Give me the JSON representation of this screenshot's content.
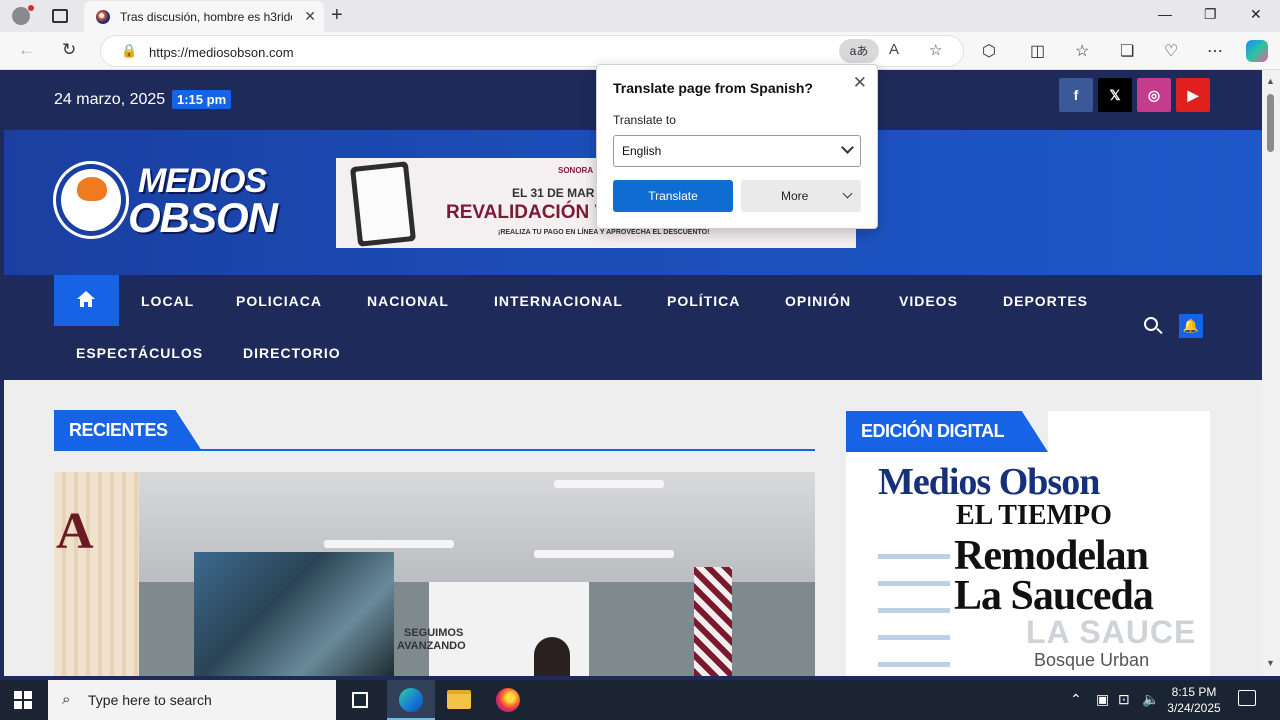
{
  "browser": {
    "tab_title": "Tras discusión, hombre es h3rido",
    "tab_close": "✕",
    "new_tab": "+",
    "url": "https://mediosobson.com",
    "translate_icon": "aあ",
    "window_controls": {
      "minimize": "—",
      "restore": "❐",
      "close": "✕"
    }
  },
  "site": {
    "date": "24 marzo, 2025",
    "time": "1:15 pm",
    "social": [
      {
        "name": "facebook",
        "glyph": "f",
        "color": "#3b5998"
      },
      {
        "name": "x",
        "glyph": "𝕏",
        "color": "#000000"
      },
      {
        "name": "instagram",
        "glyph": "◎",
        "color": "#c43c8b"
      },
      {
        "name": "youtube",
        "glyph": "▶",
        "color": "#e0201e"
      }
    ],
    "logo": {
      "line1": "MEDIOS",
      "line2": "OBSON"
    },
    "ad": {
      "brand": "SONORA",
      "line1": "EL 31 DE MAR",
      "line2": "REVALIDACIÓN V",
      "line3": "¡REALIZA TU PAGO EN LÍNEA Y APROVECHA EL DESCUENTO!"
    },
    "nav": [
      "LOCAL",
      "POLICIACA",
      "NACIONAL",
      "INTERNACIONAL",
      "POLÍTICA",
      "OPINIÓN",
      "VIDEOS",
      "DEPORTES",
      "ESPECTÁCULOS",
      "DIRECTORIO"
    ],
    "bell": "🔔"
  },
  "main": {
    "recent_heading": "RECIENTES",
    "news_image": {
      "letter": "A",
      "slogan_line1": "SEGUIMOS",
      "slogan_line2": "AVANZANDO"
    },
    "digital_heading": "EDICIÓN DIGITAL",
    "digital_cover": {
      "masthead": "Medios Obson",
      "subhead": "EL TIEMPO",
      "headline1": "Remodelan",
      "headline2": "La Sauceda",
      "sign": "LA SAUCE",
      "sign2": "Bosque Urban"
    }
  },
  "translate_popup": {
    "title": "Translate page from Spanish?",
    "label": "Translate to",
    "selected_language": "English",
    "translate_button": "Translate",
    "more_button": "More",
    "close": "✕"
  },
  "taskbar": {
    "search_placeholder": "Type here to search",
    "time": "8:15 PM",
    "date": "3/24/2025"
  }
}
